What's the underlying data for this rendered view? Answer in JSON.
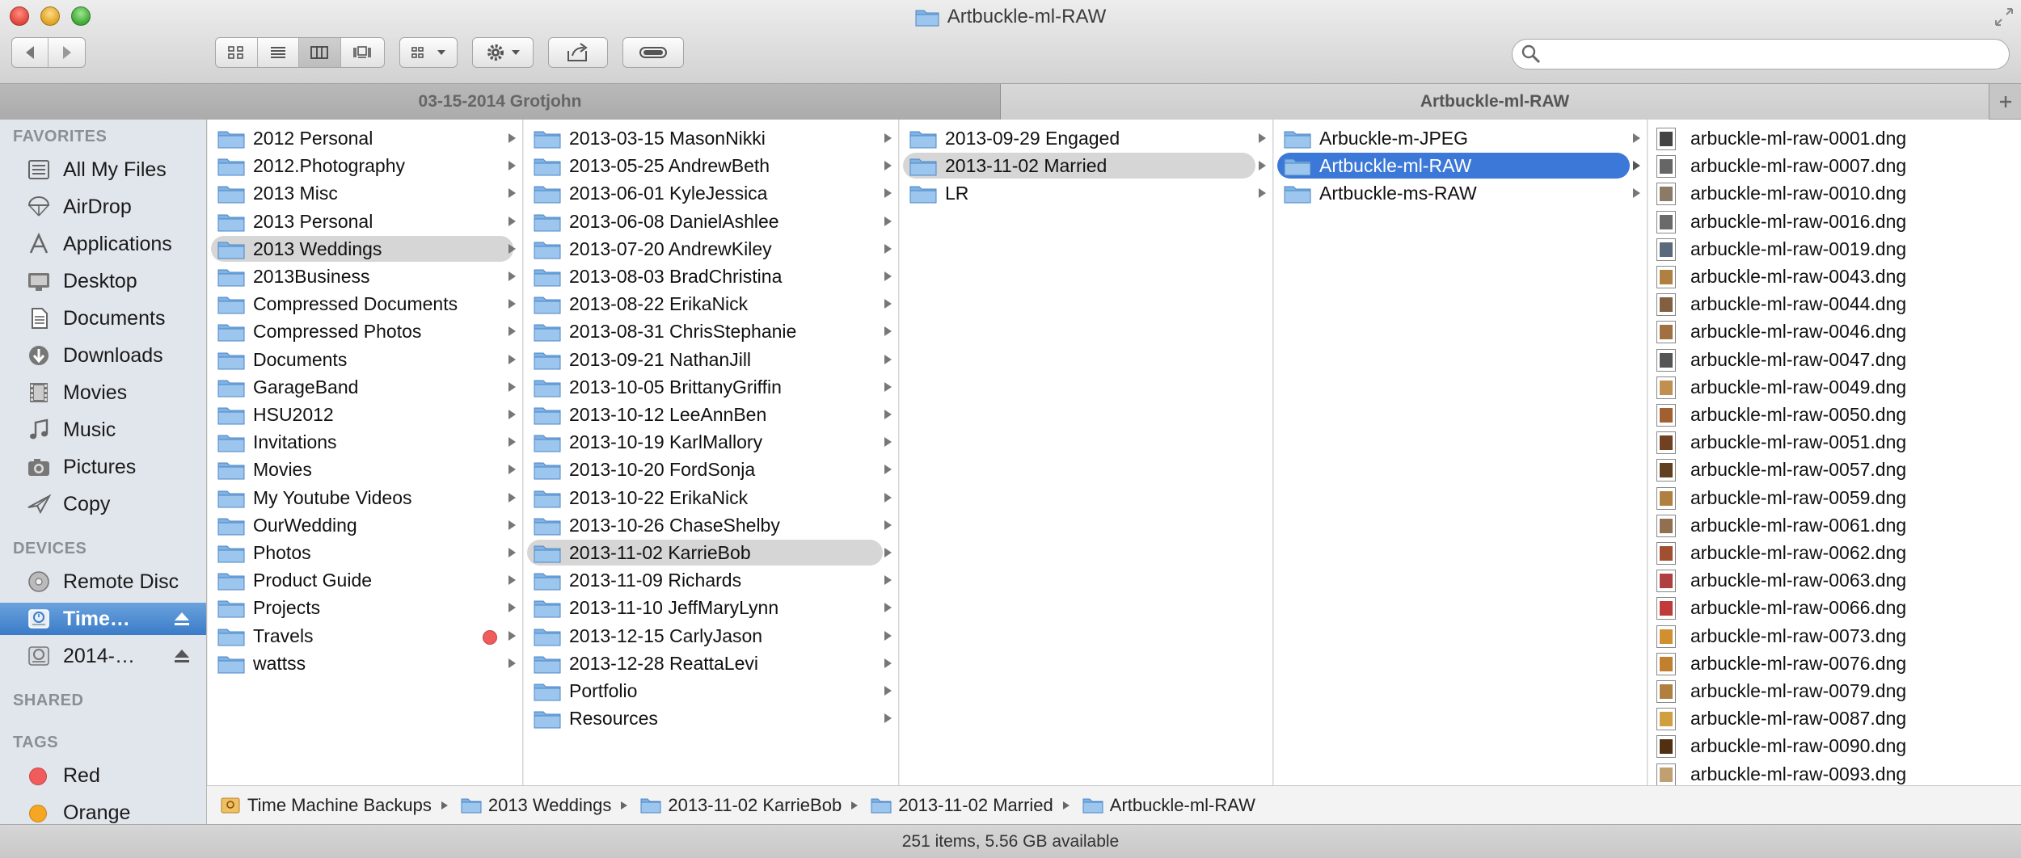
{
  "window": {
    "title": "Artbuckle-ml-RAW"
  },
  "search": {
    "placeholder": ""
  },
  "tabs": [
    {
      "label": "03-15-2014 Grotjohn",
      "active": false
    },
    {
      "label": "Artbuckle-ml-RAW",
      "active": true
    }
  ],
  "sidebar": {
    "favorites_header": "FAVORITES",
    "favorites": [
      {
        "label": "All My Files",
        "icon": "all-files-icon"
      },
      {
        "label": "AirDrop",
        "icon": "airdrop-icon"
      },
      {
        "label": "Applications",
        "icon": "applications-icon"
      },
      {
        "label": "Desktop",
        "icon": "desktop-icon"
      },
      {
        "label": "Documents",
        "icon": "documents-icon"
      },
      {
        "label": "Downloads",
        "icon": "downloads-icon"
      },
      {
        "label": "Movies",
        "icon": "movies-icon"
      },
      {
        "label": "Music",
        "icon": "music-icon"
      },
      {
        "label": "Pictures",
        "icon": "pictures-icon"
      },
      {
        "label": "Copy",
        "icon": "copy-icon"
      }
    ],
    "devices_header": "DEVICES",
    "devices": [
      {
        "label": "Remote Disc",
        "icon": "disc-icon",
        "selected": false,
        "eject": false
      },
      {
        "label": "Time…",
        "icon": "time-machine-drive-icon",
        "selected": true,
        "eject": true
      },
      {
        "label": "2014-…",
        "icon": "drive-icon",
        "selected": false,
        "eject": true
      }
    ],
    "shared_header": "SHARED",
    "tags_header": "TAGS",
    "tags": [
      {
        "label": "Red",
        "color": "#f05b5b"
      },
      {
        "label": "Orange",
        "color": "#f5a623"
      }
    ]
  },
  "columns": {
    "col1": [
      "2012 Personal",
      "2012.Photography",
      "2013 Misc",
      "2013 Personal",
      "2013 Weddings",
      "2013Business",
      "Compressed Documents",
      "Compressed Photos",
      "Documents",
      "GarageBand",
      "HSU2012",
      "Invitations",
      "Movies",
      "My Youtube Videos",
      "OurWedding",
      "Photos",
      "Product Guide",
      "Projects",
      "Travels",
      "wattss"
    ],
    "col2": [
      "2013-03-15 MasonNikki",
      "2013-05-25 AndrewBeth",
      "2013-06-01 KyleJessica",
      "2013-06-08 DanielAshlee",
      "2013-07-20 AndrewKiley",
      "2013-08-03 BradChristina",
      "2013-08-22 ErikaNick",
      "2013-08-31 ChrisStephanie",
      "2013-09-21 NathanJill",
      "2013-10-05 BrittanyGriffin",
      "2013-10-12 LeeAnnBen",
      "2013-10-19 KarlMallory",
      "2013-10-20 FordSonja",
      "2013-10-22 ErikaNick",
      "2013-10-26 ChaseShelby",
      "2013-11-02 KarrieBob",
      "2013-11-09 Richards",
      "2013-11-10 JeffMaryLynn",
      "2013-12-15 CarlyJason",
      "2013-12-28 ReattaLevi",
      "Portfolio",
      "Resources"
    ],
    "col3": [
      "2013-09-29 Engaged",
      "2013-11-02 Married",
      "LR"
    ],
    "col4": [
      "Arbuckle-m-JPEG",
      "Artbuckle-ml-RAW",
      "Artbuckle-ms-RAW"
    ],
    "col5": [
      "arbuckle-ml-raw-0001.dng",
      "arbuckle-ml-raw-0007.dng",
      "arbuckle-ml-raw-0010.dng",
      "arbuckle-ml-raw-0016.dng",
      "arbuckle-ml-raw-0019.dng",
      "arbuckle-ml-raw-0043.dng",
      "arbuckle-ml-raw-0044.dng",
      "arbuckle-ml-raw-0046.dng",
      "arbuckle-ml-raw-0047.dng",
      "arbuckle-ml-raw-0049.dng",
      "arbuckle-ml-raw-0050.dng",
      "arbuckle-ml-raw-0051.dng",
      "arbuckle-ml-raw-0057.dng",
      "arbuckle-ml-raw-0059.dng",
      "arbuckle-ml-raw-0061.dng",
      "arbuckle-ml-raw-0062.dng",
      "arbuckle-ml-raw-0063.dng",
      "arbuckle-ml-raw-0066.dng",
      "arbuckle-ml-raw-0073.dng",
      "arbuckle-ml-raw-0076.dng",
      "arbuckle-ml-raw-0079.dng",
      "arbuckle-ml-raw-0087.dng",
      "arbuckle-ml-raw-0090.dng",
      "arbuckle-ml-raw-0093.dng"
    ]
  },
  "path_bar": [
    "Time Machine Backups",
    "2013 Weddings",
    "2013-11-02 KarrieBob",
    "2013-11-02 Married",
    "Artbuckle-ml-RAW"
  ],
  "status": "251 items, 5.56 GB available",
  "colors": {
    "selection_blue": "#3b78d7",
    "selection_gray": "#d6d6d6",
    "folder_blue": "#7fb2e5",
    "red_tag": "#f05b5b",
    "orange_tag": "#f5a623"
  }
}
